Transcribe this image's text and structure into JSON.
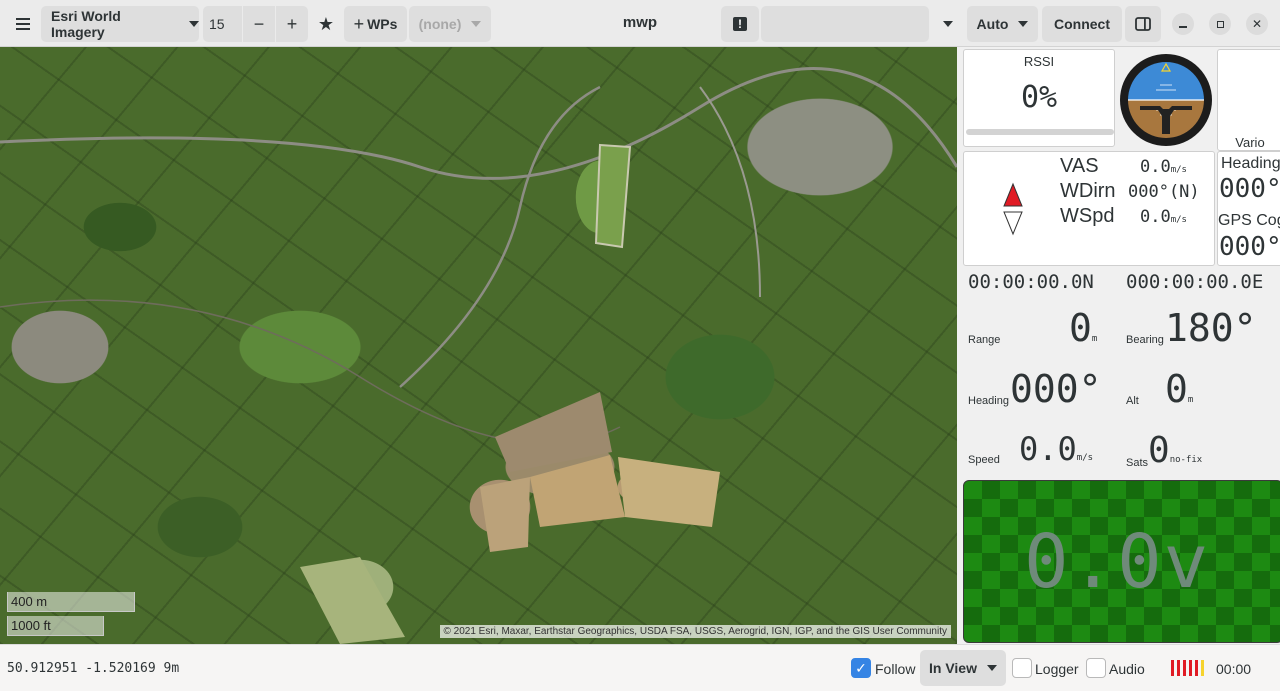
{
  "header": {
    "menu_icon": "hamburger-icon",
    "map_source": "Esri World Imagery",
    "zoom_value": "15",
    "zoom_out": "−",
    "zoom_in": "+",
    "wps_label": "WPs",
    "mission_select": "(none)",
    "title": "mwp",
    "warn_label": "!",
    "device_value": "",
    "mode_select": "Auto",
    "connect_label": "Connect"
  },
  "map": {
    "scale_m": "400 m",
    "scale_ft": "1000 ft",
    "attribution": "© 2021 Esri, Maxar, Earthstar Geographics, USDA FSA, USGS, Aerogrid, IGN, IGP, and the GIS User Community"
  },
  "rssi": {
    "label": "RSSI",
    "value": "0%",
    "level": 0
  },
  "vario": {
    "label": "Vario"
  },
  "wind": {
    "vas_label": "VAS",
    "vas_value": "0.0",
    "vas_unit": "m/s",
    "wdirn_label": "WDirn",
    "wdirn_value": "000°(N)",
    "wspd_label": "WSpd",
    "wspd_value": "0.0",
    "wspd_unit": "m/s"
  },
  "heading_panel": {
    "heading_label": "Heading",
    "heading_value": "000°",
    "gpscog_label": "GPS Cog",
    "gpscog_value": "000°"
  },
  "nav": {
    "lat": "00:00:00.0N",
    "lon": "000:00:00.0E",
    "range_label": "Range",
    "range_value": "0",
    "range_unit": "m",
    "bearing_label": "Bearing",
    "bearing_value": "180°",
    "heading_label": "Heading",
    "heading_value": "000°",
    "alt_label": "Alt",
    "alt_value": "0",
    "alt_unit": "m",
    "speed_label": "Speed",
    "speed_value": "0.0",
    "speed_unit": "m/s",
    "sats_label": "Sats",
    "sats_value": "0",
    "sats_unit": "no-fix"
  },
  "battery": {
    "value": "0.0v"
  },
  "status": {
    "coords": "50.912951 -1.520169 9m",
    "follow_label": "Follow",
    "view_select": "In View",
    "logger_label": "Logger",
    "audio_label": "Audio",
    "time": "00:00"
  },
  "colors": {
    "accent": "#3584e4",
    "battery_green": "#1d8a12",
    "signal_red": "#e01b24"
  }
}
